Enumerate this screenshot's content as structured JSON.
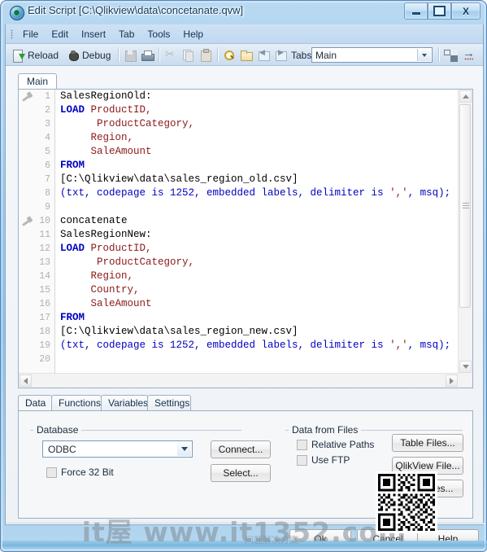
{
  "window": {
    "title": "Edit Script [C:\\Qlikview\\data\\concetanate.qvw]",
    "minimize_label": "Minimize",
    "maximize_label": "Maximize",
    "close_label": "X"
  },
  "menu": {
    "items": [
      "File",
      "Edit",
      "Insert",
      "Tab",
      "Tools",
      "Help"
    ]
  },
  "toolbar": {
    "reload_label": "Reload",
    "debug_label": "Debug",
    "tabs_label": "Tabs",
    "tabs_value": "Main",
    "icons": [
      "reload-icon",
      "debug-icon",
      "save-icon",
      "print-icon",
      "cut-icon",
      "copy-icon",
      "paste-icon",
      "find-icon",
      "open-folder-icon",
      "previous-tab-icon",
      "next-tab-icon",
      "organize-tabs-icon",
      "goto-icon"
    ]
  },
  "script_tabs": [
    {
      "label": "Main",
      "active": true
    }
  ],
  "editor": {
    "lines": [
      {
        "num": "1",
        "fold": true,
        "tokens": [
          {
            "t": "SalesRegionOld:",
            "c": "plain"
          }
        ]
      },
      {
        "num": "2",
        "fold": false,
        "tokens": [
          {
            "t": "LOAD",
            "c": "kw"
          },
          {
            "t": " ",
            "c": "plain"
          },
          {
            "t": "ProductID,",
            "c": "fld"
          }
        ]
      },
      {
        "num": "3",
        "fold": false,
        "tokens": [
          {
            "t": "      ",
            "c": "plain"
          },
          {
            "t": "ProductCategory,",
            "c": "fld"
          }
        ]
      },
      {
        "num": "4",
        "fold": false,
        "tokens": [
          {
            "t": "     ",
            "c": "plain"
          },
          {
            "t": "Region,",
            "c": "fld"
          }
        ]
      },
      {
        "num": "5",
        "fold": false,
        "tokens": [
          {
            "t": "     ",
            "c": "plain"
          },
          {
            "t": "SaleAmount",
            "c": "fld"
          }
        ]
      },
      {
        "num": "6",
        "fold": false,
        "tokens": [
          {
            "t": "FROM",
            "c": "kw"
          }
        ]
      },
      {
        "num": "7",
        "fold": false,
        "tokens": [
          {
            "t": "[C:\\Qlikview\\data\\sales_region_old.csv]",
            "c": "plain"
          }
        ]
      },
      {
        "num": "8",
        "fold": false,
        "tokens": [
          {
            "t": "(txt, codepage is 1252, embedded labels, delimiter is ",
            "c": "kw2"
          },
          {
            "t": "','",
            "c": "str"
          },
          {
            "t": ", msq);",
            "c": "kw2"
          }
        ]
      },
      {
        "num": "9",
        "fold": false,
        "tokens": [
          {
            "t": "",
            "c": "plain"
          }
        ]
      },
      {
        "num": "10",
        "fold": true,
        "tokens": [
          {
            "t": "concatenate",
            "c": "plain"
          }
        ]
      },
      {
        "num": "11",
        "fold": false,
        "tokens": [
          {
            "t": "SalesRegionNew:",
            "c": "plain"
          }
        ]
      },
      {
        "num": "12",
        "fold": false,
        "tokens": [
          {
            "t": "LOAD",
            "c": "kw"
          },
          {
            "t": " ",
            "c": "plain"
          },
          {
            "t": "ProductID,",
            "c": "fld"
          }
        ]
      },
      {
        "num": "13",
        "fold": false,
        "tokens": [
          {
            "t": "      ",
            "c": "plain"
          },
          {
            "t": "ProductCategory,",
            "c": "fld"
          }
        ]
      },
      {
        "num": "14",
        "fold": false,
        "tokens": [
          {
            "t": "     ",
            "c": "plain"
          },
          {
            "t": "Region,",
            "c": "fld"
          }
        ]
      },
      {
        "num": "15",
        "fold": false,
        "tokens": [
          {
            "t": "     ",
            "c": "plain"
          },
          {
            "t": "Country,",
            "c": "fld"
          }
        ]
      },
      {
        "num": "16",
        "fold": false,
        "tokens": [
          {
            "t": "     ",
            "c": "plain"
          },
          {
            "t": "SaleAmount",
            "c": "fld"
          }
        ]
      },
      {
        "num": "17",
        "fold": false,
        "tokens": [
          {
            "t": "FROM",
            "c": "kw"
          }
        ]
      },
      {
        "num": "18",
        "fold": false,
        "tokens": [
          {
            "t": "[C:\\Qlikview\\data\\sales_region_new.csv]",
            "c": "plain"
          }
        ]
      },
      {
        "num": "19",
        "fold": false,
        "tokens": [
          {
            "t": "(txt, codepage is 1252, embedded labels, delimiter is ",
            "c": "kw2"
          },
          {
            "t": "','",
            "c": "str"
          },
          {
            "t": ", msq);",
            "c": "kw2"
          }
        ]
      },
      {
        "num": "20",
        "fold": false,
        "tokens": [
          {
            "t": "",
            "c": "plain"
          }
        ]
      }
    ]
  },
  "bottom_panel": {
    "tabs": [
      {
        "label": "Data",
        "active": true
      },
      {
        "label": "Functions",
        "active": false
      },
      {
        "label": "Variables",
        "active": false
      },
      {
        "label": "Settings",
        "active": false
      }
    ],
    "database_group": {
      "title": "Database",
      "driver_value": "ODBC",
      "connect_label": "Connect...",
      "select_label": "Select...",
      "force32_label": "Force 32 Bit",
      "force32_checked": false
    },
    "files_group": {
      "title": "Data from Files",
      "relative_paths_label": "Relative Paths",
      "relative_paths_checked": false,
      "use_ftp_label": "Use FTP",
      "use_ftp_checked": false,
      "table_files_label": "Table Files...",
      "qlikview_file_label": "QlikView File...",
      "web_files_label": "Web Files..."
    }
  },
  "actions": {
    "ok_label": "Ok",
    "cancel_label": "Cancel",
    "help_label": "Help"
  },
  "overlay": {
    "watermark_text": "it屋 www.it1352.com",
    "watermark_sub": "问题解决方案",
    "qr_name": "qr-code"
  },
  "colors": {
    "accent": "#0000c0",
    "field": "#8b1a1a",
    "title_text": "#123a5e"
  }
}
